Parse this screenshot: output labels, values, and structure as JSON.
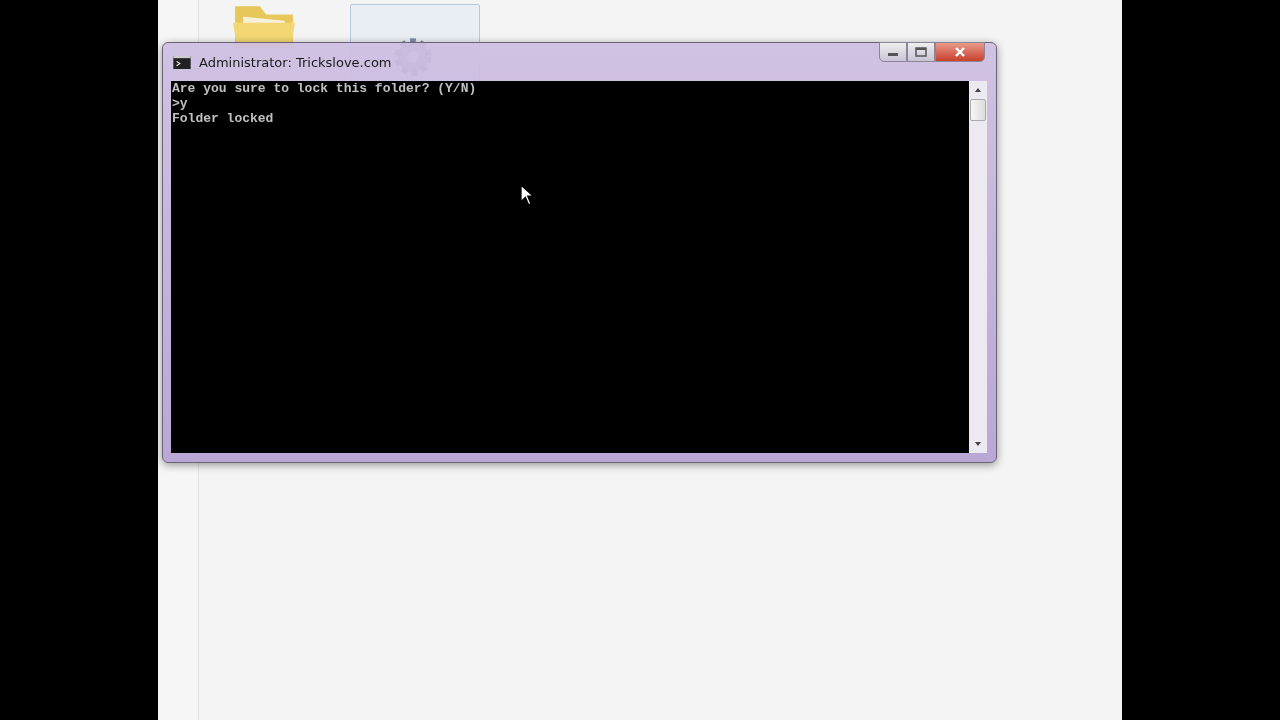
{
  "window": {
    "title": "Administrator: Trickslove.com"
  },
  "console": {
    "lines": [
      "Are you sure to lock this folder? (Y/N)",
      ">y",
      "Folder locked"
    ]
  }
}
